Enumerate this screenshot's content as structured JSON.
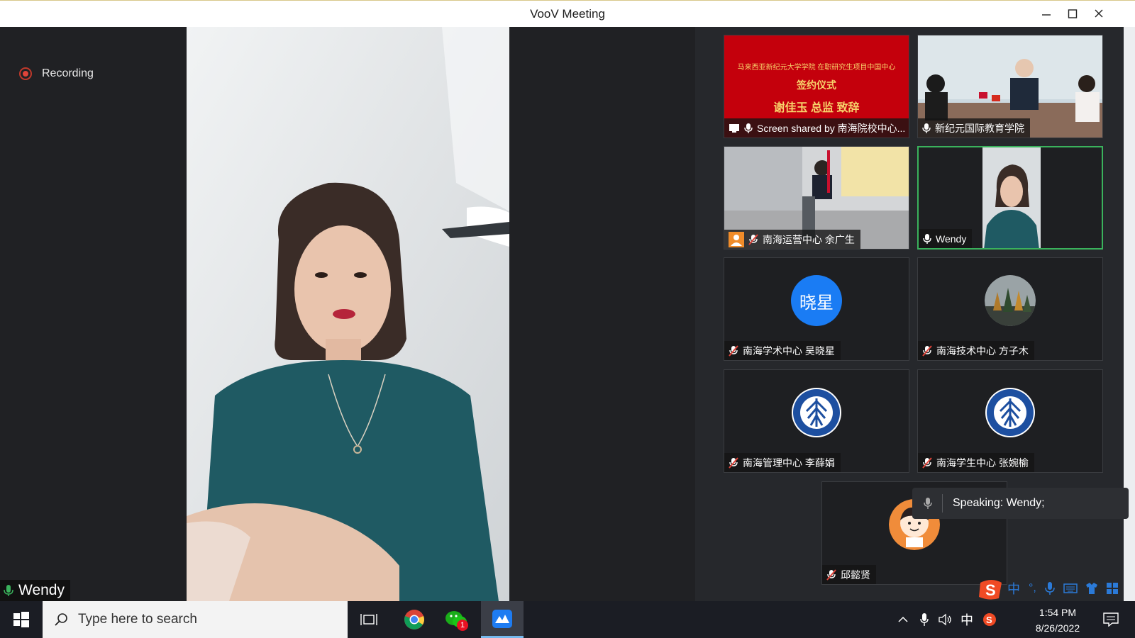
{
  "window": {
    "title": "VooV Meeting"
  },
  "recording": {
    "label": "Recording"
  },
  "main_speaker": {
    "name": "Wendy"
  },
  "tiles": [
    {
      "label": "Screen shared by 南海院校中心...",
      "slide": {
        "header": "马来西亚新纪元大学学院 在职研究生项目中国中心",
        "line1": "签约仪式",
        "line2": "谢佳玉 总监 致辞"
      }
    },
    {
      "label": "新纪元国际教育学院"
    },
    {
      "label": "南海运营中心 余广生"
    },
    {
      "label": "Wendy"
    },
    {
      "label": "南海学术中心 吴晓星",
      "avatar_text": "晓星"
    },
    {
      "label": "南海技术中心 方子木"
    },
    {
      "label": "南海管理中心 李薛娟"
    },
    {
      "label": "南海学生中心 张婉榆"
    },
    {
      "label": "邱懿贤"
    }
  ],
  "speaking": {
    "text": "Speaking: Wendy;"
  },
  "taskbar": {
    "search_placeholder": "Type here to search",
    "wechat_badge": "1",
    "ime_lang": "中",
    "time": "1:54 PM",
    "date": "8/26/2022"
  },
  "ime_toolbar": {
    "lang": "中",
    "punct": "°,"
  },
  "colors": {
    "active_border": "#3ab25c",
    "record_red": "#e0443a",
    "avatar_blue": "#1a7cf4",
    "slide_red": "#c4000c"
  }
}
